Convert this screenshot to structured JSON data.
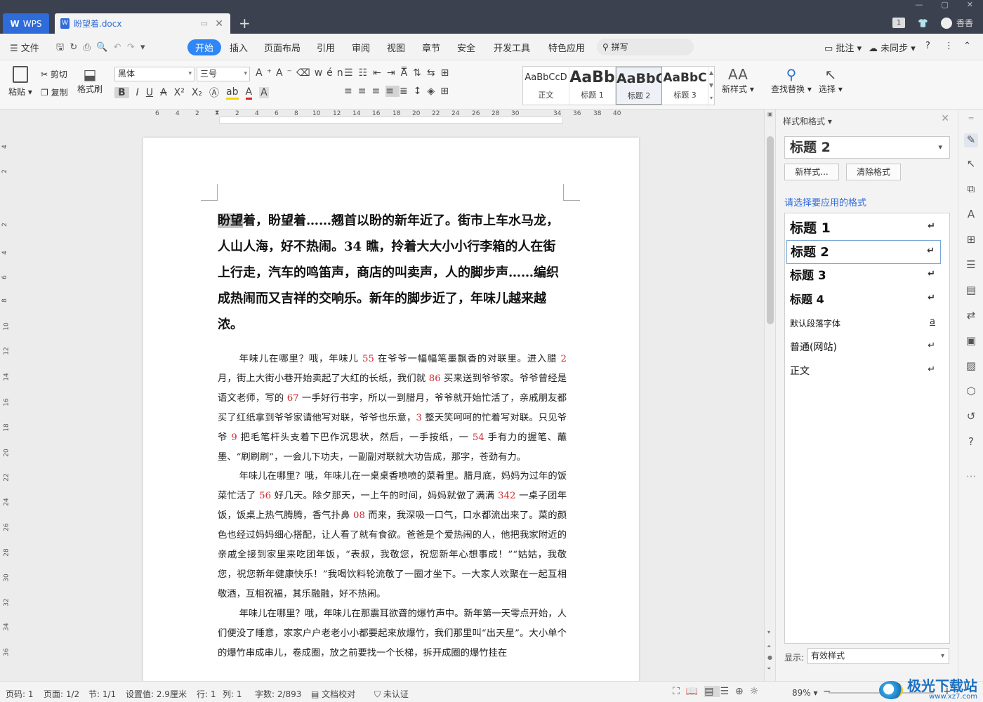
{
  "titlebar": {
    "app_tab": "WPS",
    "doc_tab": "盼望着.docx",
    "new_tab": "+",
    "user": "香香",
    "page_badge": "1"
  },
  "menu": {
    "file": "文件",
    "tabs": [
      "开始",
      "插入",
      "页面布局",
      "引用",
      "审阅",
      "视图",
      "章节",
      "安全",
      "开发工具",
      "特色应用"
    ],
    "search": "拼写",
    "comment": "批注",
    "sync": "未同步",
    "help": "?"
  },
  "ribbon": {
    "paste": "粘贴",
    "cut": "剪切",
    "copy": "复制",
    "format_painter": "格式刷",
    "font_name": "黑体",
    "font_size": "三号",
    "styles": [
      {
        "preview": "AaBbCcD",
        "label": "正文"
      },
      {
        "preview": "AaBb",
        "label": "标题 1"
      },
      {
        "preview": "AaBbC",
        "label": "标题 2"
      },
      {
        "preview": "AaBbC",
        "label": "标题 3"
      }
    ],
    "new_style": "新样式",
    "find_replace": "查找替换",
    "select": "选择"
  },
  "ruler": {
    "h_marks": [
      "6",
      "4",
      "2",
      "2",
      "4",
      "6",
      "8",
      "10",
      "12",
      "14",
      "16",
      "18",
      "20",
      "22",
      "24",
      "26",
      "28",
      "30",
      "34",
      "36",
      "38",
      "40"
    ],
    "v_marks": [
      "4",
      "2",
      "2",
      "4",
      "6",
      "8",
      "10",
      "12",
      "14",
      "16",
      "18",
      "20",
      "22",
      "24",
      "26",
      "28",
      "30",
      "32",
      "34",
      "36"
    ]
  },
  "document": {
    "heading_hl": "盼望",
    "heading_rest": "着，盼望着……翘首以盼的新年近了。街市上车水马龙，人山人海，好不热闹。34 瞧，拎着大大小小行李箱的人在街上行走，汽车的鸣笛声，商店的叫卖声，人的脚步声……编织成热闹而又吉祥的交响乐。新年的脚步近了，年味儿越来越浓。",
    "paragraphs": [
      [
        {
          "t": "年味儿在哪里？哦，年味儿 "
        },
        {
          "n": "55"
        },
        {
          "t": " 在爷爷一幅幅笔墨飘香的对联里。进入腊 "
        },
        {
          "n": "2"
        },
        {
          "t": " 月，街上大街小巷开始卖起了大红的长纸，我们就 "
        },
        {
          "n": "86"
        },
        {
          "t": " 买来送到爷爷家。爷爷曾经是语文老师，写的 "
        },
        {
          "n": "67"
        },
        {
          "t": " 一手好行书字，所以一到腊月，爷爷就开始忙活了，亲戚朋友都买了红纸拿到爷爷家请他写对联，爷爷也乐意，"
        },
        {
          "n": "3"
        },
        {
          "t": " 整天笑呵呵的忙着写对联。只见爷爷 "
        },
        {
          "n": "9"
        },
        {
          "t": " 把毛笔杆头支着下巴作沉思状，然后，一手按纸，一 "
        },
        {
          "n": "54"
        },
        {
          "t": " 手有力的握笔、蘸墨、“刷刷刷”，一会儿下功夫，一副副对联就大功告成，那字，苍劲有力。"
        }
      ],
      [
        {
          "t": "年味儿在哪里？哦，年味儿在一桌桌香喷喷的菜肴里。腊月底，妈妈为过年的饭菜忙活了 "
        },
        {
          "n": "56"
        },
        {
          "t": " 好几天。除夕那天，一上午的时间，妈妈就做了满满 "
        },
        {
          "n": "342"
        },
        {
          "t": " 一桌子团年饭，饭桌上热气腾腾，香气扑鼻 "
        },
        {
          "n": "08"
        },
        {
          "t": " 而来，我深吸一口气，口水都流出来了。菜的颜色也经过妈妈细心搭配，让人看了就有食欲。爸爸是个爱热闹的人，他把我家附近的亲戚全接到家里来吃团年饭，“表叔，我敬您，祝您新年心想事成！”“姑姑，我敬您，祝您新年健康快乐！”我喝饮料轮流敬了一圈才坐下。一大家人欢聚在一起互相敬酒，互相祝福，其乐融融，好不热闹。"
        }
      ],
      [
        {
          "t": "年味儿在哪里？哦，年味儿在那震耳欲聋的爆竹声中。新年第一天零点开始，人们便没了睡意，家家户户老老小小都要起来放爆竹，我们那里叫“出天星”。大小单个的爆竹串成串儿，卷成圈，放之前要找一个长梯，拆开成圈的爆竹挂在"
        }
      ]
    ]
  },
  "panel": {
    "title": "样式和格式",
    "current_style": "标题  2",
    "new_style_btn": "新样式...",
    "clear_btn": "清除格式",
    "apply_label": "请选择要应用的格式",
    "styles": [
      {
        "name": "标题  1",
        "mark": "↵"
      },
      {
        "name": "标题  2",
        "mark": "↵"
      },
      {
        "name": "标题  3",
        "mark": "↵"
      },
      {
        "name": "标题  4",
        "mark": "↵"
      },
      {
        "name": "默认段落字体",
        "mark": "a"
      },
      {
        "name": "普通(网站)",
        "mark": "↵"
      },
      {
        "name": "正文",
        "mark": "↵"
      }
    ],
    "show_label": "显示:",
    "show_value": "有效样式"
  },
  "status": {
    "page_no": "页码: 1",
    "pages": "页面: 1/2",
    "section": "节: 1/1",
    "setting": "设置值: 2.9厘米",
    "row": "行: 1",
    "col": "列: 1",
    "words": "字数: 2/893",
    "proof": "文档校对",
    "cert": "未认证",
    "zoom": "89%"
  },
  "watermark": {
    "brand": "极光下载站",
    "url": "www.xz7.com"
  },
  "colors": {
    "accent": "#2f86f6",
    "number_red": "#d0272d",
    "titlebar": "#3c4150"
  }
}
